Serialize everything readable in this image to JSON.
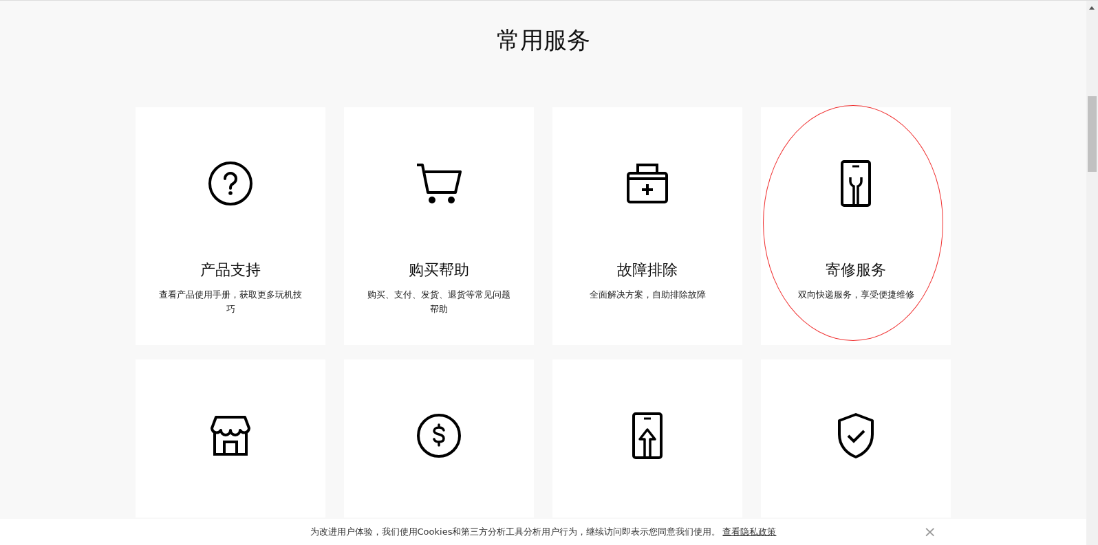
{
  "heading": "常用服务",
  "cards": [
    {
      "kind": "question",
      "title": "产品支持",
      "description": "查看产品使用手册，获取更多玩机技巧",
      "highlighted": false
    },
    {
      "kind": "cart",
      "title": "购买帮助",
      "description": "购买、支付、发货、退货等常见问题帮助",
      "highlighted": false
    },
    {
      "kind": "medkit",
      "title": "故障排除",
      "description": "全面解决方案，自助排除故障",
      "highlighted": false
    },
    {
      "kind": "repair",
      "title": "寄修服务",
      "description": "双向快递服务，享受便捷维修",
      "highlighted": true
    },
    {
      "kind": "store"
    },
    {
      "kind": "dollar"
    },
    {
      "kind": "update"
    },
    {
      "kind": "shield"
    }
  ],
  "cookie_notice": {
    "text": "为改进用户体验，我们使用Cookies和第三方分析工具分析用户行为，继续访问即表示您同意我们使用。",
    "link": "查看隐私政策",
    "close": "×"
  }
}
